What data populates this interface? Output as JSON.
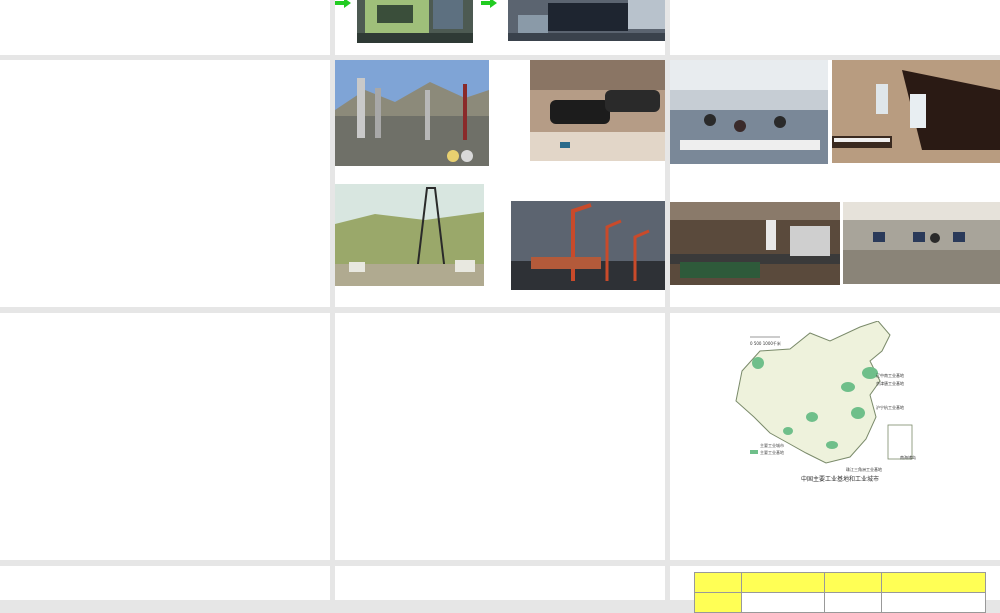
{
  "slides": [
    {
      "id": "r1c1"
    },
    {
      "id": "r1c2"
    },
    {
      "id": "r1c3"
    },
    {
      "id": "r2c1"
    },
    {
      "id": "r2c2"
    },
    {
      "id": "r2c3"
    },
    {
      "id": "r3c1"
    },
    {
      "id": "r3c2"
    },
    {
      "id": "r3c3"
    },
    {
      "id": "r4c1"
    },
    {
      "id": "r4c2"
    },
    {
      "id": "r4c3"
    }
  ],
  "photos": {
    "factory_machine": "factory-machine-photo",
    "car_assembly_top": "assembly-line-photo",
    "refinery": "oil-refinery-photo",
    "car_factory": "car-factory-photo",
    "garment_workshop": "garment-workshop-photo",
    "piano_workshop": "piano-workshop-photo",
    "oil_derrick": "oil-derrick-photo",
    "shipyard": "shipyard-cranes-photo",
    "bottling_line": "bottling-line-photo",
    "electronics_line": "electronics-line-photo"
  },
  "map": {
    "title": "中国主要工业基地和工业城市",
    "legend": [
      "主要工业城市",
      "主要工业基地"
    ],
    "labels": [
      "辽中南工业基地",
      "京津唐工业基地",
      "沪宁杭工业基地",
      "珠江三角洲工业基地"
    ],
    "scale": "0     500     1000千米",
    "inset": "南海诸岛"
  },
  "colors": {
    "accent_green": "#22cc22",
    "table_header": "#ffff55",
    "map_land": "#eef2dc",
    "map_region": "#6fbf8a"
  }
}
